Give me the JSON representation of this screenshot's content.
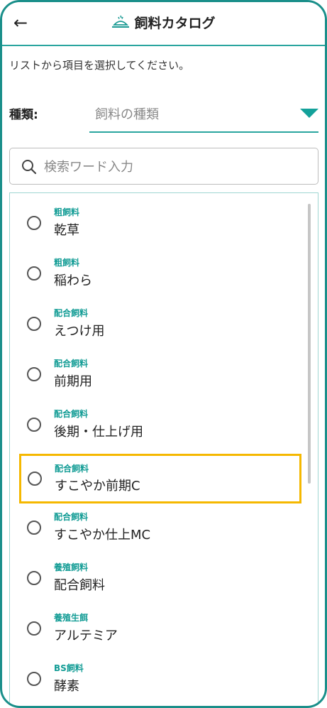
{
  "header": {
    "back_icon": "←",
    "title": "飼料カタログ"
  },
  "instruction": "リストから項目を選択してください。",
  "filter": {
    "label": "種類:",
    "placeholder": "飼料の種類"
  },
  "search": {
    "placeholder": "検索ワード入力"
  },
  "colors": {
    "accent": "#2aa59f",
    "category": "#129c95",
    "highlight": "#f5b800"
  },
  "items": [
    {
      "category": "粗飼料",
      "name": "乾草"
    },
    {
      "category": "粗飼料",
      "name": "稲わら"
    },
    {
      "category": "配合飼料",
      "name": "えつけ用"
    },
    {
      "category": "配合飼料",
      "name": "前期用"
    },
    {
      "category": "配合飼料",
      "name": "後期・仕上げ用"
    },
    {
      "category": "配合飼料",
      "name": "すこやか前期C"
    },
    {
      "category": "配合飼料",
      "name": "すこやか仕上MC"
    },
    {
      "category": "養殖飼料",
      "name": "配合飼料"
    },
    {
      "category": "養殖生餌",
      "name": "アルテミア"
    },
    {
      "category": "BS飼料",
      "name": "酵素"
    }
  ]
}
